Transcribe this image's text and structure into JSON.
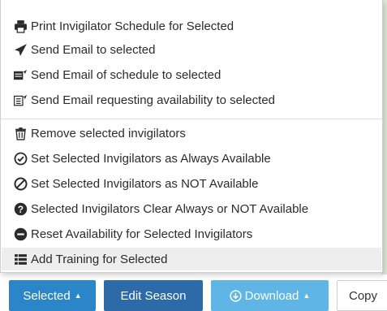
{
  "menu": {
    "group1": [
      {
        "label": "Print Invigilator Schedule for Selected",
        "icon": "print-icon"
      },
      {
        "label": "Send Email to selected",
        "icon": "paper-plane-icon"
      },
      {
        "label": "Send Email of schedule to selected",
        "icon": "calendar-send-icon"
      },
      {
        "label": "Send Email requesting availability to selected",
        "icon": "form-send-icon"
      }
    ],
    "group2": [
      {
        "label": "Remove selected invigilators",
        "icon": "trash-icon"
      },
      {
        "label": "Set Selected Invigilators as Always Available",
        "icon": "check-circle-icon"
      },
      {
        "label": "Set Selected Invigilators as NOT Available",
        "icon": "ban-icon"
      },
      {
        "label": "Selected Invigilators Clear Always or NOT Available",
        "icon": "question-circle-icon"
      },
      {
        "label": "Reset Availability for Selected Invigilators",
        "icon": "minus-circle-icon"
      },
      {
        "label": "Add Training for Selected",
        "icon": "list-icon"
      }
    ]
  },
  "toolbar": {
    "selected_label": "Selected",
    "edit_season_label": "Edit Season",
    "download_label": "Download",
    "copy_label": "Copy"
  },
  "colors": {
    "selected_button": "#2a86c8",
    "edit_button": "#2d6aa8",
    "download_button": "#5fb6e6",
    "hover_row": "#eeeeee"
  }
}
